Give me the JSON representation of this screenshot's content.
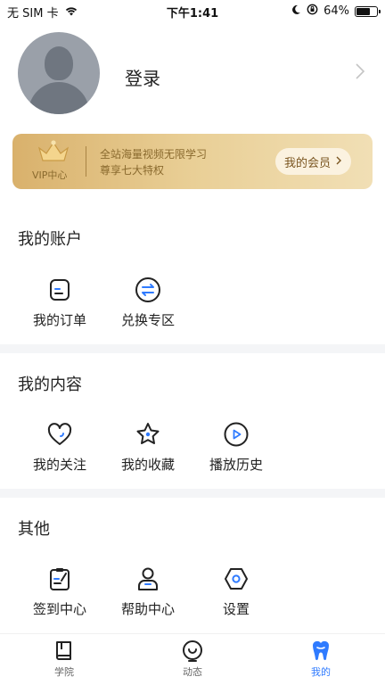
{
  "status_bar": {
    "carrier": "无 SIM 卡",
    "time": "下午1:41",
    "battery_text": "64%",
    "battery_level": 0.64
  },
  "profile": {
    "login_label": "登录"
  },
  "vip": {
    "badge_label": "VIP中心",
    "line1": "全站海量视频无限学习",
    "line2": "尊享七大特权",
    "member_button": "我的会员"
  },
  "sections": {
    "account": {
      "title": "我的账户",
      "items": [
        {
          "label": "我的订单",
          "icon": "order-icon"
        },
        {
          "label": "兑换专区",
          "icon": "exchange-icon"
        }
      ]
    },
    "content": {
      "title": "我的内容",
      "items": [
        {
          "label": "我的关注",
          "icon": "heart-icon"
        },
        {
          "label": "我的收藏",
          "icon": "star-icon"
        },
        {
          "label": "播放历史",
          "icon": "play-history-icon"
        }
      ]
    },
    "other": {
      "title": "其他",
      "items": [
        {
          "label": "签到中心",
          "icon": "checkin-icon"
        },
        {
          "label": "帮助中心",
          "icon": "help-icon"
        },
        {
          "label": "设置",
          "icon": "settings-icon"
        }
      ]
    }
  },
  "tabbar": {
    "tabs": [
      {
        "label": "学院",
        "icon": "book-icon",
        "active": false
      },
      {
        "label": "动态",
        "icon": "feed-icon",
        "active": false
      },
      {
        "label": "我的",
        "icon": "tooth-icon",
        "active": true
      }
    ]
  },
  "colors": {
    "accent": "#2f7bff",
    "vip_gold": "#d9b16c"
  }
}
